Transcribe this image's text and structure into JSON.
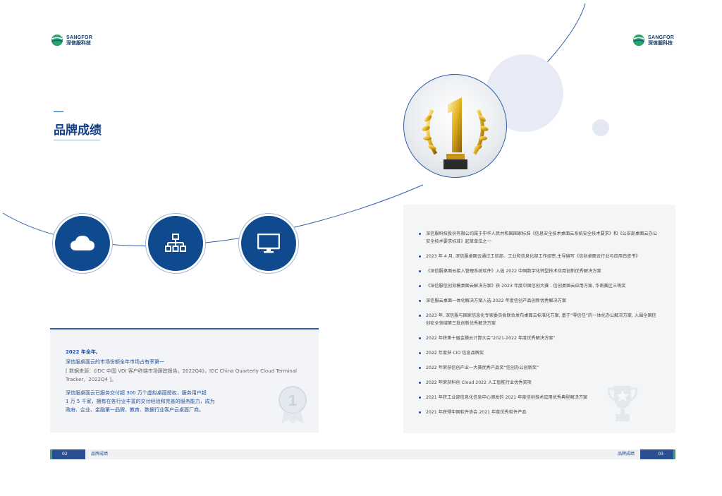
{
  "logo": {
    "en": "SANGFOR",
    "cn": "深信服科技"
  },
  "section_title": "品牌成绩",
  "feature_icons": [
    "cloud-icon",
    "network-tree-icon",
    "monitor-icon"
  ],
  "left_card": {
    "year_line": "2022 年全年,",
    "sub_line": "深信服桌面云的市场份额全年市场占有率第一",
    "source_line": "[ 数据来源：《IDC 中国 VDI 客户终端市场跟踪报告，2022Q4》，IDC China Quarterly Cloud Terminal Tracker，2022Q4 ]。",
    "body_lines": [
      "深信服桌面云已服务交付超 300 万个虚拟桌面授权，服务用户超",
      "1 万 5 千家，拥有在各行业丰富的交付经验和完善的服务能力，成为",
      "政府、企业、金融第一品牌、教育、数据行业客户云桌面厂商。"
    ]
  },
  "right_card": {
    "items": [
      "深信服科技股份有限公司属于中华人民共和国国家标准《信息安全技术桌面云系统安全技术要求》和《公安部桌面云办公安全技术要求标准》起草单位之一",
      "2023 年 4 月, 深信服桌面云通过工信部、工业和信息化部工作组审,主导编写《信创桌面云行业与应用白皮书》",
      "《深信服桌面云接入管理系统软件》入选 2022 中国数字化转型技术应用创新优秀解决方案",
      "《深信服信创双模桌面云解决方案》获 2023 年度中国信创大赛 - 信创桌面云应用方案, 华南赛区三等奖",
      "深信服云桌面一体化解决方案入选 2022 年度信创产品创新优秀解决方案",
      "2023 年, 深信服与国家信息化专家委员会联合发布桌面云标准化方案, 基于“零信任”的一体化办公解决方案, 入围全国信创安全领域第三批创新优秀解决方案",
      "2022 年获第十届金猿云计算大会“2021-2022 年度优秀解决方案”",
      "2022 年度获 CIO 信息品牌奖",
      "2022 年荣获信创产业一大赛优秀产品奖“信创办公创新奖”",
      "2022 年荣获科创 Cloud 2022 人工智能行业优秀奖项",
      "2021 年获工业部信息化信息中心颁发的 2021 年度信创技术应用优秀典型解决方案",
      "2021 年获得中国软件协会 2021 年度优秀软件产品"
    ]
  },
  "footer": {
    "left_page": "02",
    "left_label": "品牌成绩",
    "right_label": "品牌成绩",
    "right_page": "03"
  },
  "colors": {
    "brand_blue": "#0f4a8f",
    "title_blue": "#143f86"
  }
}
